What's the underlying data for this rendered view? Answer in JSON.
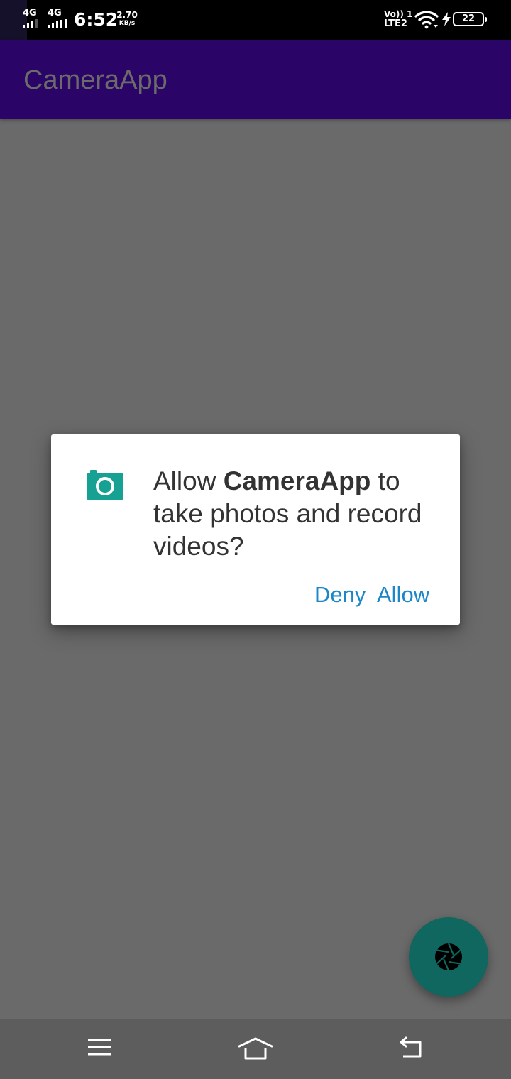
{
  "status_bar": {
    "sim1": "4G",
    "sim2": "4G",
    "time": "6:52",
    "speed_value": "2.70",
    "speed_unit": "KB/s",
    "volte_line1": "Vo)) 1",
    "volte_line2": "LTE2",
    "battery_level": "22"
  },
  "app_bar": {
    "title": "CameraApp"
  },
  "dialog": {
    "message_prefix": "Allow ",
    "message_app": "CameraApp",
    "message_suffix": " to take photos and record videos?",
    "deny_label": "Deny",
    "allow_label": "Allow",
    "icon": "camera-icon"
  },
  "fab": {
    "icon": "camera-shutter-icon"
  },
  "nav_bar": {
    "menu_icon": "menu-icon",
    "home_icon": "home-icon",
    "back_icon": "back-icon"
  },
  "colors": {
    "app_bar": "#2a0466",
    "scrim_background": "#6a6a6a",
    "dialog_button": "#1b87c9",
    "camera_icon": "#16a193",
    "fab": "#0f6760"
  }
}
